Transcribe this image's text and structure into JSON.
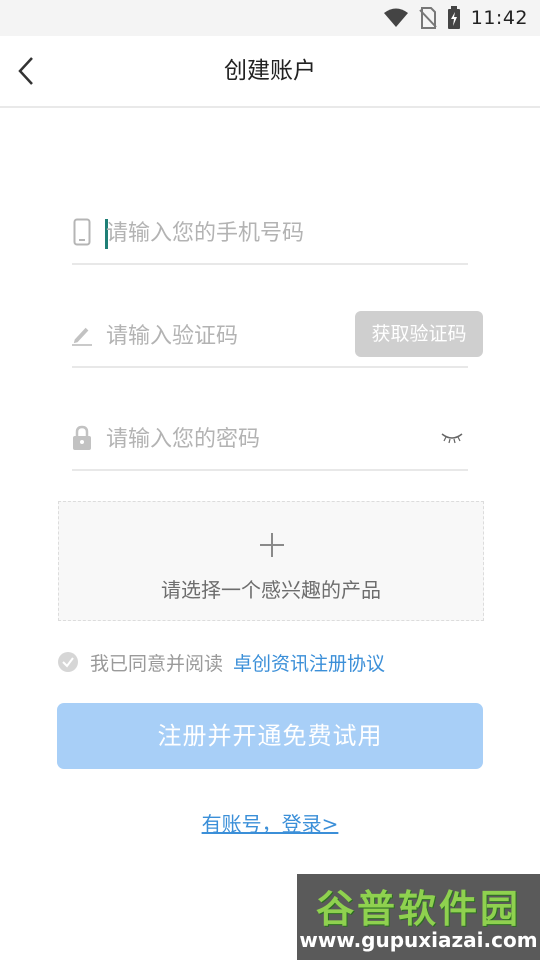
{
  "status_bar": {
    "time": "11:42",
    "icons": [
      "wifi-icon",
      "no-sim-icon",
      "battery-charging-icon"
    ]
  },
  "nav": {
    "title": "创建账户",
    "back_icon": "chevron-left-icon"
  },
  "form": {
    "phone": {
      "placeholder": "请输入您的手机号码",
      "value": "",
      "icon": "phone-icon"
    },
    "code": {
      "placeholder": "请输入验证码",
      "value": "",
      "icon": "pencil-icon",
      "button_label": "获取验证码"
    },
    "password": {
      "placeholder": "请输入您的密码",
      "value": "",
      "icon": "lock-icon",
      "toggle_icon": "eye-closed-icon"
    }
  },
  "product_picker": {
    "label": "请选择一个感兴趣的产品",
    "icon": "plus-icon"
  },
  "agreement": {
    "text": "我已同意并阅读",
    "link": "卓创资讯注册协议",
    "checked": true
  },
  "submit": {
    "label": "注册并开通免费试用"
  },
  "login_link": {
    "label": "有账号，登录>"
  },
  "watermark": {
    "title": "谷普软件园",
    "url": "www.gupuxiazai.com"
  },
  "colors": {
    "accent": "#3b8fd8",
    "submit_bg": "#a8cff7",
    "code_button_bg": "#cfcfcf",
    "cursor": "#1f7f76"
  }
}
